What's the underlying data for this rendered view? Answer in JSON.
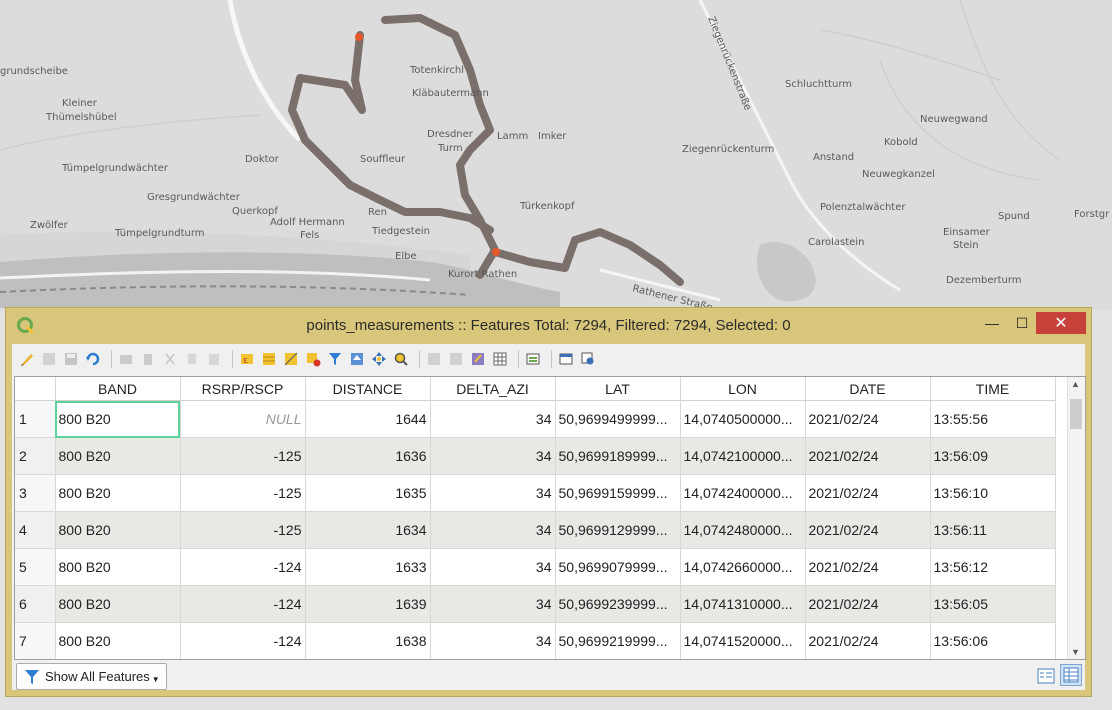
{
  "window": {
    "title": "points_measurements :: Features Total: 7294, Filtered: 7294, Selected: 0",
    "minimize": "—",
    "maximize": "☐",
    "close": "✕"
  },
  "map": {
    "labels": [
      "grundscheibe",
      "Kleiner",
      "Thümelshübel",
      "Tümpelgrundwächter",
      "Gresgrundwächter",
      "Querkopf",
      "Adolf Hermann",
      "Fels",
      "Zwölfer",
      "Tümpelgrundturm",
      "Doktor",
      "Souffleur",
      "Totenkirchl",
      "Kläbautermann",
      "Dresdner",
      "Turm",
      "Lamm",
      "Imker",
      "Ren",
      "Tiedgestein",
      "Türkenkopf",
      "Elbe",
      "Kurort Rathen",
      "Rathener Straße",
      "Schluchtturm",
      "Neuwegwand",
      "Kobold",
      "Neuwegkanzel",
      "Ziegenrückenturm",
      "Anstand",
      "Polenztalwächter",
      "Carolastein",
      "Einsamer",
      "Stein",
      "Spund",
      "Dezemberturm",
      "Forstgr",
      "Ziegenrückenstraße"
    ]
  },
  "toolbar": {
    "icons": [
      "pencil-icon",
      "toggle-multi-edit-icon",
      "save-icon",
      "reload-icon",
      "add-feature-icon",
      "delete-icon",
      "cut-icon",
      "copy-icon",
      "paste-icon",
      "expression-select-icon",
      "select-all-icon",
      "invert-selection-icon",
      "deselect-icon",
      "filter-icon",
      "move-top-icon",
      "pan-to-icon",
      "zoom-to-icon",
      "new-field-icon",
      "delete-field-icon",
      "field-calc-icon",
      "conditional-format-icon",
      "actions-icon",
      "dock-icon",
      "organize-columns-icon"
    ]
  },
  "table": {
    "columns": [
      "BAND",
      "RSRP/RSCP",
      "DISTANCE",
      "DELTA_AZI",
      "LAT",
      "LON",
      "DATE",
      "TIME"
    ],
    "rows": [
      {
        "id": "1",
        "band": "800 B20",
        "rsrp": "NULL",
        "distance": "1644",
        "delta_azi": "34",
        "lat": "50,9699499999...",
        "lon": "14,0740500000...",
        "date": "2021/02/24",
        "time": "13:55:56"
      },
      {
        "id": "2",
        "band": "800 B20",
        "rsrp": "-125",
        "distance": "1636",
        "delta_azi": "34",
        "lat": "50,9699189999...",
        "lon": "14,0742100000...",
        "date": "2021/02/24",
        "time": "13:56:09"
      },
      {
        "id": "3",
        "band": "800 B20",
        "rsrp": "-125",
        "distance": "1635",
        "delta_azi": "34",
        "lat": "50,9699159999...",
        "lon": "14,0742400000...",
        "date": "2021/02/24",
        "time": "13:56:10"
      },
      {
        "id": "4",
        "band": "800 B20",
        "rsrp": "-125",
        "distance": "1634",
        "delta_azi": "34",
        "lat": "50,9699129999...",
        "lon": "14,0742480000...",
        "date": "2021/02/24",
        "time": "13:56:11"
      },
      {
        "id": "5",
        "band": "800 B20",
        "rsrp": "-124",
        "distance": "1633",
        "delta_azi": "34",
        "lat": "50,9699079999...",
        "lon": "14,0742660000...",
        "date": "2021/02/24",
        "time": "13:56:12"
      },
      {
        "id": "6",
        "band": "800 B20",
        "rsrp": "-124",
        "distance": "1639",
        "delta_azi": "34",
        "lat": "50,9699239999...",
        "lon": "14,0741310000...",
        "date": "2021/02/24",
        "time": "13:56:05"
      },
      {
        "id": "7",
        "band": "800 B20",
        "rsrp": "-124",
        "distance": "1638",
        "delta_azi": "34",
        "lat": "50,9699219999...",
        "lon": "14,0741520000...",
        "date": "2021/02/24",
        "time": "13:56:06"
      }
    ]
  },
  "bottom": {
    "show_all_label": "Show All Features"
  },
  "colors": {
    "dialog_frame": "#d8c77a",
    "close_button": "#c7403a",
    "track": "#7a6f6a",
    "track_points": "#e8572a",
    "selected_cell": "#5dd39a"
  }
}
